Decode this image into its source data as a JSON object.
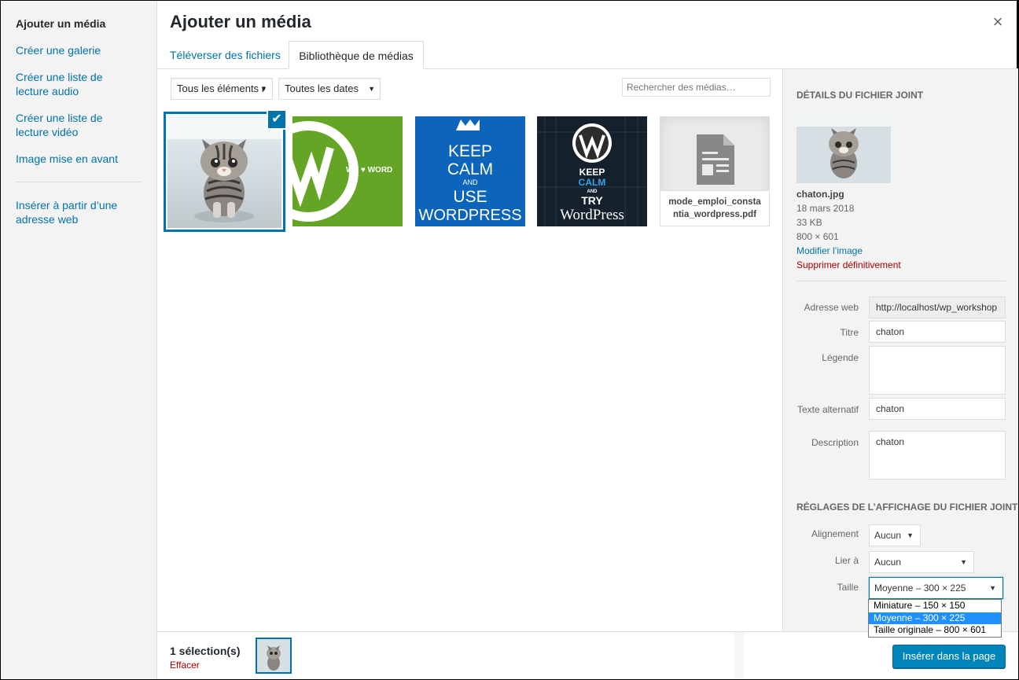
{
  "menu": {
    "items": [
      {
        "label": "Ajouter un média"
      },
      {
        "label": "Créer une galerie"
      },
      {
        "label": "Créer une liste de lecture audio"
      },
      {
        "label": "Créer une liste de lecture vidéo"
      },
      {
        "label": "Image mise en avant"
      },
      {
        "label": "Insérer à partir d’une adresse web"
      }
    ]
  },
  "header": {
    "title": "Ajouter un média",
    "close_glyph": "×",
    "tabs": [
      {
        "label": "Téléverser des fichiers"
      },
      {
        "label": "Bibliothèque de médias"
      }
    ]
  },
  "toolbar": {
    "filter_type": "Tous les éléments r",
    "filter_date": "Toutes les dates",
    "search_placeholder": "Rechercher des médias…"
  },
  "attachments": [
    {
      "kind": "image",
      "subject": "kitten",
      "selected": true
    },
    {
      "kind": "image",
      "subject": "we-love-wordpress",
      "text": "WE ♥ WORD"
    },
    {
      "kind": "image",
      "subject": "keep-calm-use-wordpress",
      "lines": [
        "KEEP",
        "CALM",
        "AND",
        "USE",
        "WORDPRESS"
      ]
    },
    {
      "kind": "image",
      "subject": "keep-calm-try-wordpress",
      "lines": [
        "KEEP",
        "CALM",
        "AND",
        "TRY",
        "WordPress"
      ]
    },
    {
      "kind": "document",
      "icon": "document-icon",
      "filename": "mode_emploi_constantia_wordpress.pdf"
    }
  ],
  "colors": {
    "accent": "#0073aa",
    "danger": "#a00000",
    "green_tile": "#65a526",
    "blue_tile": "#0c65ba",
    "button": "#0085ba"
  },
  "details": {
    "heading": "Détails du fichier joint",
    "filename": "chaton.jpg",
    "date": "18 mars 2018",
    "size": "33 KB",
    "dimensions": "800 × 601",
    "edit_link": "Modifier l’image",
    "delete_link": "Supprimer définitivement",
    "fields": {
      "url_label": "Adresse web",
      "url_value": "http://localhost/wp_workshop",
      "title_label": "Titre",
      "title_value": "chaton",
      "caption_label": "Légende",
      "caption_value": "",
      "alt_label": "Texte alternatif",
      "alt_value": "chaton",
      "description_label": "Description",
      "description_value": "chaton"
    }
  },
  "display_settings": {
    "heading": "Réglages de l’affichage du fichier joint",
    "alignment_label": "Alignement",
    "alignment_value": "Aucun",
    "link_label": "Lier à",
    "link_value": "Aucun",
    "size_label": "Taille",
    "size_value": "Moyenne – 300 × 225",
    "size_options": [
      "Miniature – 150 × 150",
      "Moyenne – 300 × 225",
      "Taille originale – 800 × 601"
    ],
    "size_highlighted": "Moyenne – 300 × 225"
  },
  "bottom": {
    "selection_count": "1 sélection(s)",
    "clear_label": "Effacer",
    "insert_button": "Insérer dans la page"
  }
}
